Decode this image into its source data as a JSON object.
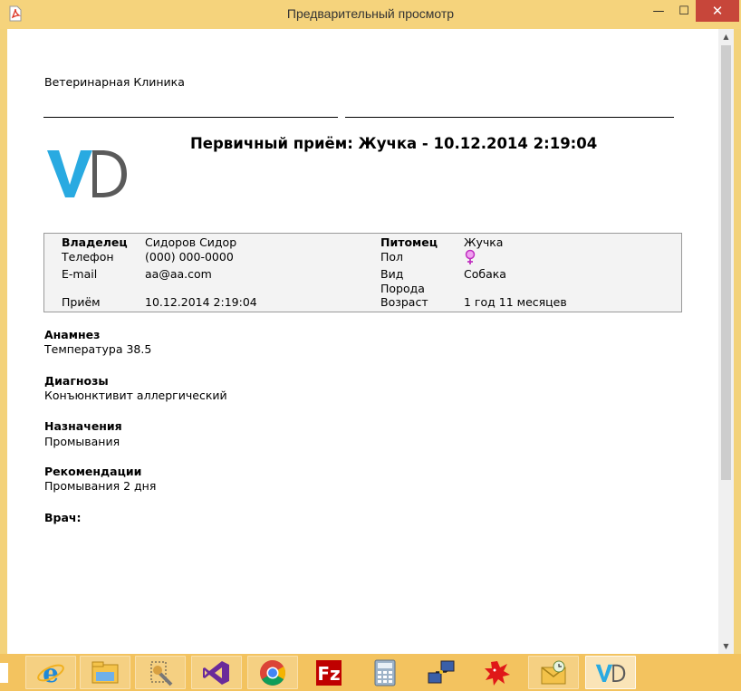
{
  "window": {
    "title": "Предварительный просмотр"
  },
  "controls": {
    "minimize": "—",
    "maximize": "☐",
    "close": "✕"
  },
  "scrollbar": {
    "up": "▲",
    "down": "▼"
  },
  "document": {
    "clinic_name": "Ветеринарная Клиника",
    "logo_text": "VD",
    "title": "Первичный приём: Жучка - 10.12.2014 2:19:04",
    "info": {
      "owner_label": "Владелец",
      "owner_value": "Сидоров Сидор",
      "phone_label": "Телефон",
      "phone_value": "(000) 000-0000",
      "email_label": "E-mail",
      "email_value": "aa@aa.com",
      "visit_label": "Приём",
      "visit_value": "10.12.2014 2:19:04",
      "pet_label": "Питомец",
      "pet_value": "Жучка",
      "sex_label": "Пол",
      "species_label": "Вид",
      "species_value": "Собака",
      "breed_label": "Порода",
      "age_label": "Возраст",
      "age_value": "1 год 11 месяцев"
    },
    "sections": [
      {
        "heading": "Анамнез",
        "text": "Температура 38.5"
      },
      {
        "heading": "Диагнозы",
        "text": "Конъюнктивит аллергический"
      },
      {
        "heading": "Назначения",
        "text": "Промывания"
      },
      {
        "heading": "Рекомендации",
        "text": "Промывания 2 дня"
      },
      {
        "heading": "Врач:",
        "text": ""
      }
    ]
  },
  "taskbar": {
    "items": [
      {
        "name": "internet-explorer-icon"
      },
      {
        "name": "file-explorer-icon"
      },
      {
        "name": "tools-app-icon"
      },
      {
        "name": "visual-studio-icon"
      },
      {
        "name": "chrome-icon"
      },
      {
        "name": "filezilla-icon"
      },
      {
        "name": "calculator-icon"
      },
      {
        "name": "network-app-icon"
      },
      {
        "name": "red-splat-app-icon"
      },
      {
        "name": "outlook-icon"
      },
      {
        "name": "vd-app-icon",
        "label": "VD"
      }
    ]
  },
  "colors": {
    "accent": "#29aae1",
    "logo_gray": "#5a5a5a",
    "frame": "#f5d37c",
    "close": "#c7463a",
    "female": "#d63ad6"
  }
}
